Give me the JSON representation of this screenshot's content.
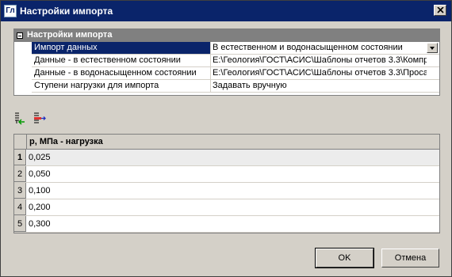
{
  "window": {
    "title": "Настройки импорта",
    "icon_label": "Гл"
  },
  "properties": {
    "section_title": "Настройки импорта",
    "rows": [
      {
        "name": "Импорт данных",
        "value": "В естественном и водонасыщенном состоянии"
      },
      {
        "name": "Данные - в естественном состоянии",
        "value": "E:\\Геология\\ГОСТ\\АСИС\\Шаблоны отчетов 3.3\\Компр..."
      },
      {
        "name": "Данные - в водонасыщенном состоянии",
        "value": "E:\\Геология\\ГОСТ\\АСИС\\Шаблоны отчетов 3.3\\Проса..."
      },
      {
        "name": "Ступени нагрузки для импорта",
        "value": "Задавать вручную"
      }
    ]
  },
  "toolbar": {
    "icons": [
      "add-row-icon",
      "delete-row-icon"
    ]
  },
  "grid": {
    "column": "p, МПа - нагрузка",
    "rows": [
      {
        "n": "1",
        "v": "0,025"
      },
      {
        "n": "2",
        "v": "0,050"
      },
      {
        "n": "3",
        "v": "0,100"
      },
      {
        "n": "4",
        "v": "0,200"
      },
      {
        "n": "5",
        "v": "0,300"
      }
    ]
  },
  "buttons": {
    "ok": "OK",
    "cancel": "Отмена"
  },
  "colors": {
    "titlebar": "#0a246a",
    "selection": "#0a246a",
    "face": "#d4d0c8"
  }
}
